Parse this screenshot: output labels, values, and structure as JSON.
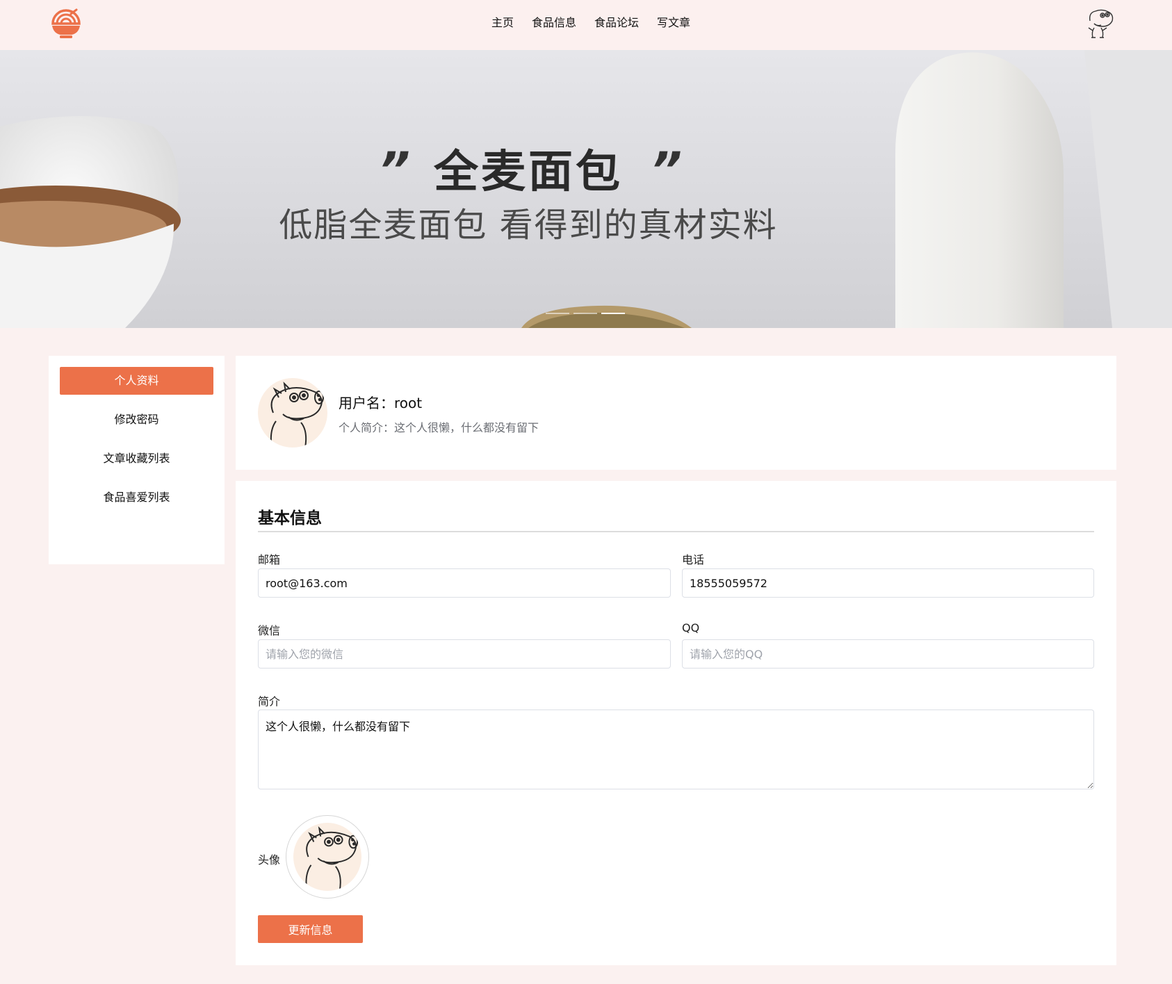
{
  "nav": {
    "items": [
      "主页",
      "食品信息",
      "食品论坛",
      "写文章"
    ]
  },
  "banner": {
    "title": "全麦面包",
    "quote_open": "”",
    "quote_close": "”",
    "subtitle": "低脂全麦面包 看得到的真材实料",
    "slide_count": 3,
    "active_slide": 3
  },
  "sidebar": {
    "items": [
      {
        "label": "个人资料",
        "active": true
      },
      {
        "label": "修改密码",
        "active": false
      },
      {
        "label": "文章收藏列表",
        "active": false
      },
      {
        "label": "食品喜爱列表",
        "active": false
      }
    ]
  },
  "profile": {
    "username_line": "用户名：root",
    "bio_line": "个人简介：这个人很懒，什么都没有留下"
  },
  "form": {
    "section_title": "基本信息",
    "email": {
      "label": "邮箱",
      "value": "root@163.com",
      "placeholder": ""
    },
    "phone": {
      "label": "电话",
      "value": "18555059572",
      "placeholder": ""
    },
    "wechat": {
      "label": "微信",
      "value": "",
      "placeholder": "请输入您的微信"
    },
    "qq": {
      "label": "QQ",
      "value": "",
      "placeholder": "请输入您的QQ"
    },
    "bio": {
      "label": "简介",
      "value": "这个人很懒，什么都没有留下"
    },
    "avatar_label": "头像",
    "submit_label": "更新信息"
  },
  "colors": {
    "accent": "#ec7149",
    "page_background": "#fbf1f0",
    "avatar_background": "#fbeee3"
  },
  "icons": {
    "logo": "noodle-bowl-icon",
    "user_avatar": "peppa-pig-avatar"
  }
}
